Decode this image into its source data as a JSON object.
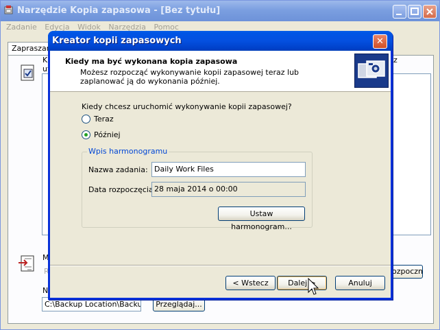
{
  "background_window": {
    "title": "Narzędzie Kopia zapasowa - [Bez tytułu]",
    "menu": [
      "Zadanie",
      "Edycja",
      "Widok",
      "Narzędzia",
      "Pomoc"
    ],
    "tab_label": "Zapraszam",
    "fragment_k": "K",
    "fragment_ut": "ut",
    "fragment_z": "z",
    "fragment_m": "M",
    "fragment_r": "R",
    "fragment_n": "N",
    "right_button_label": "ozpocznij",
    "path_value": "C:\\Backup Location\\Backup",
    "browse_label": "Przeglądaj..."
  },
  "dialog": {
    "title": "Kreator kopii zapasowych",
    "close_glyph": "✕",
    "header_title": "Kiedy ma być wykonana kopia zapasowa",
    "header_subtitle": "Możesz rozpocząć wykonywanie kopii zapasowej teraz lub zaplanować ją do wykonania później.",
    "question": "Kiedy chcesz uruchomić wykonywanie kopii zapasowej?",
    "radio_now": {
      "label": "Teraz",
      "checked": false
    },
    "radio_later": {
      "label": "Później",
      "checked": true
    },
    "schedule_group": {
      "legend": "Wpis harmonogramu",
      "job_name_label": "Nazwa zadania:",
      "job_name_value": "Daily Work Files",
      "start_date_label": "Data rozpoczęcia:",
      "start_date_value": "28 maja 2014 o 00:00",
      "set_schedule_label": "Ustaw harmonogram..."
    },
    "back_label": "< Wstecz",
    "next_label": "Dalej >",
    "cancel_label": "Anuluj"
  },
  "colors": {
    "dialog_titlebar": "#0055e5",
    "inactive_titlebar": "#7b9fe0",
    "group_legend": "#0046d5",
    "radio_dot": "#21a121"
  }
}
